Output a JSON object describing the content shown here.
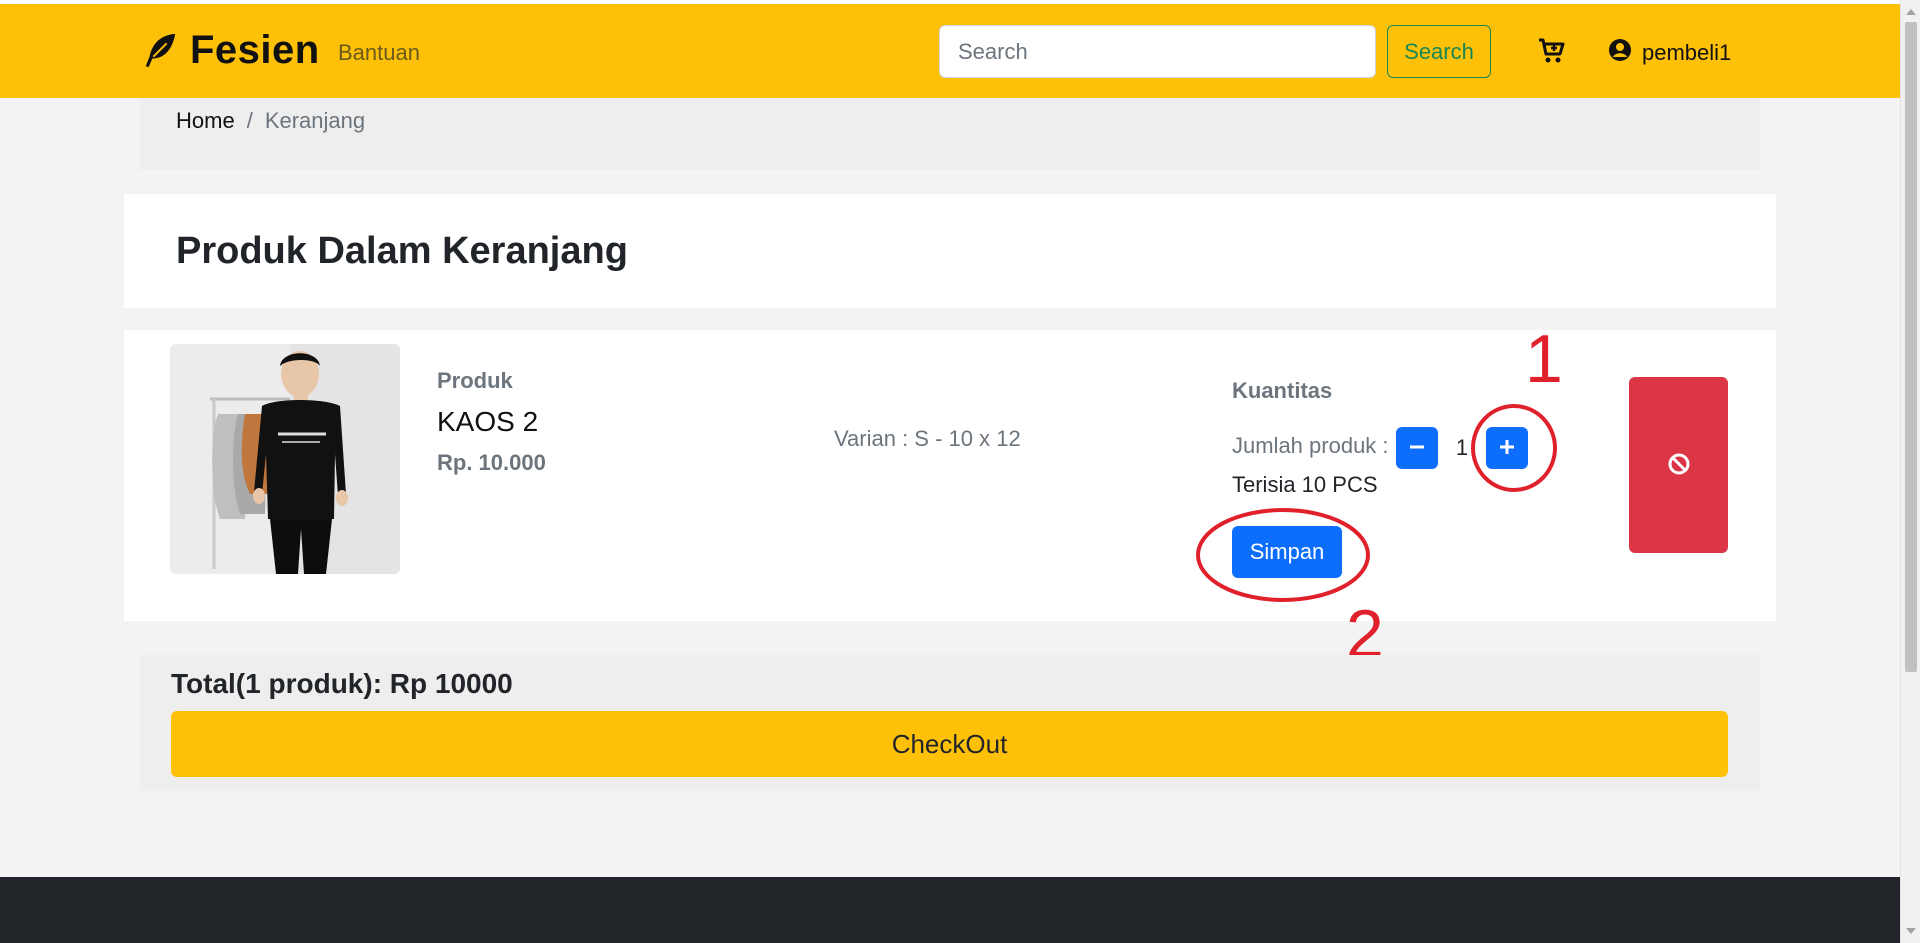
{
  "navbar": {
    "brand": "Fesien",
    "help_link": "Bantuan",
    "search_placeholder": "Search",
    "search_button": "Search",
    "username": "pembeli1"
  },
  "breadcrumb": {
    "home": "Home",
    "separator": "/",
    "current": "Keranjang"
  },
  "page_title": "Produk Dalam Keranjang",
  "cart_item": {
    "product_label": "Produk",
    "name": "KAOS 2",
    "price": "Rp. 10.000",
    "variant": "Varian : S - 10 x 12",
    "quantity_title": "Kuantitas",
    "quantity_label": "Jumlah produk :",
    "quantity": "1",
    "stock": "Terisia 10 PCS",
    "save_button": "Simpan"
  },
  "annotations": {
    "first": "1",
    "second": "2"
  },
  "summary": {
    "total": "Total(1 produk): Rp 10000",
    "checkout_button": "CheckOut"
  },
  "colors": {
    "navbar": "#ffc107",
    "primary": "#0d6efd",
    "danger": "#dc3545",
    "success": "#198754",
    "footer": "#212529",
    "annotation": "#e0202a"
  },
  "icons": {
    "brand": "feather-icon",
    "cart": "cart-plus-icon",
    "user": "user-circle-icon",
    "minus": "minus-icon",
    "plus": "plus-icon",
    "delete": "ban-icon"
  }
}
